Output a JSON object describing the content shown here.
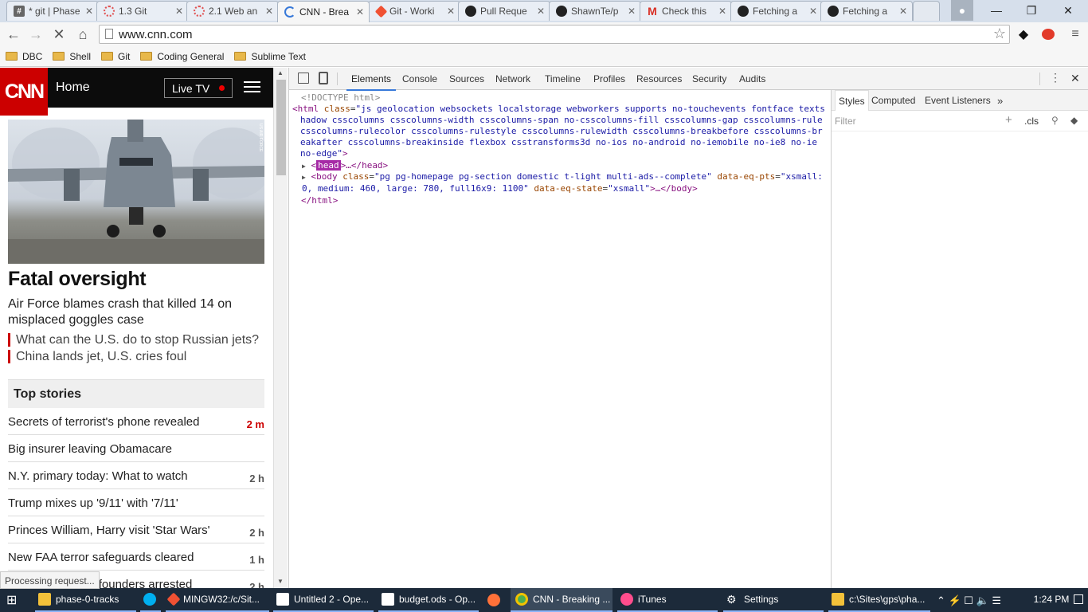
{
  "tabs": [
    {
      "title": "* git | Phase",
      "icon": "hash-icon",
      "color": "#555555"
    },
    {
      "title": "1.3 Git",
      "icon": "loading-icon",
      "color": "#e05050"
    },
    {
      "title": "2.1 Web an",
      "icon": "loading-icon",
      "color": "#e05050"
    },
    {
      "title": "CNN - Brea",
      "icon": "spinner-icon",
      "color": "#3879d9"
    },
    {
      "title": "Git - Worki",
      "icon": "git-icon",
      "color": "#f05133"
    },
    {
      "title": "Pull Reque",
      "icon": "github-icon",
      "color": "#222222"
    },
    {
      "title": "ShawnTe/p",
      "icon": "github-icon",
      "color": "#222222"
    },
    {
      "title": "Check this",
      "icon": "gmail-icon",
      "color": "#d93025"
    },
    {
      "title": "Fetching a",
      "icon": "github-icon",
      "color": "#222222"
    },
    {
      "title": "Fetching a",
      "icon": "github-icon",
      "color": "#222222"
    }
  ],
  "omnibox": {
    "url": "www.cnn.com"
  },
  "bookmarks": [
    "DBC",
    "Shell",
    "Git",
    "Coding General",
    "Sublime Text"
  ],
  "cnn": {
    "logo": "CNN",
    "home": "Home",
    "live_tv": "Live TV",
    "hero_credit": "US AIR FORCE",
    "headline": "Fatal oversight",
    "subhead": "Air Force blames crash that killed 14 on misplaced goggles case",
    "related": [
      "What can the U.S. do to stop Russian jets?",
      "China lands jet, U.S. cries foul"
    ],
    "top_stories_title": "Top stories",
    "stories": [
      {
        "title": "Secrets of terrorist's phone revealed",
        "ago": "2 m"
      },
      {
        "title": "Big insurer leaving Obamacare",
        "ago": ""
      },
      {
        "title": "N.Y. primary today: What to watch",
        "ago": "2 h"
      },
      {
        "title": "Trump mixes up '9/11' with '7/11'",
        "ago": ""
      },
      {
        "title": "Princes William, Harry visit 'Star Wars'",
        "ago": "2 h"
      },
      {
        "title": "New FAA terror safeguards cleared",
        "ago": "1 h"
      },
      {
        "title": "Ben & Jerry's co-founders arrested",
        "ago": "2 h"
      }
    ],
    "status": "Processing request..."
  },
  "devtools": {
    "tabs": [
      "Elements",
      "Console",
      "Sources",
      "Network",
      "Timeline",
      "Profiles",
      "Resources",
      "Security",
      "Audits"
    ],
    "active_tab": "Elements",
    "doctype": "<!DOCTYPE html>",
    "html_open": "<html",
    "html_class_attr": "class",
    "html_class_value": "\"js geolocation websockets localstorage webworkers supports no-touchevents fontface textshadow csscolumns csscolumns-width csscolumns-span no-csscolumns-fill csscolumns-gap csscolumns-rule csscolumns-rulecolor csscolumns-rulestyle csscolumns-rulewidth csscolumns-breakbefore csscolumns-breakafter csscolumns-breakinside flexbox csstransforms3d no-ios no-android no-iemobile no-ie8 no-ie no-edge\"",
    "head_tag": "head",
    "head_rest": ">…</head>",
    "body_open": "<body",
    "body_class_attr": "class",
    "body_class_value": "\"pg pg-homepage pg-section domestic t-light multi-ads--complete\"",
    "body_pts_attr": "data-eq-pts",
    "body_pts_value": "\"xsmall: 0, medium: 460, large: 780, full16x9: 1100\"",
    "body_state_attr": "data-eq-state",
    "body_state_value": "\"xsmall\"",
    "body_rest": ">…</body>",
    "html_close": "</html>",
    "styles_tabs": [
      "Styles",
      "Computed",
      "Event Listeners"
    ],
    "filter_placeholder": "Filter",
    "cls": ".cls"
  },
  "taskbar": {
    "items": [
      {
        "label": "phase-0-tracks",
        "icon_color": "#f3c13a"
      },
      {
        "label": "",
        "icon_color": "#00aff0"
      },
      {
        "label": "MINGW32:/c/Sit...",
        "icon_color": "#f05133"
      },
      {
        "label": "Untitled 2 - Ope...",
        "icon_color": "#ffffff"
      },
      {
        "label": "budget.ods - Op...",
        "icon_color": "#ffffff"
      },
      {
        "label": "",
        "icon_color": "#ff7139"
      },
      {
        "label": "CNN - Breaking ...",
        "icon_color": "#4caf50"
      },
      {
        "label": "iTunes",
        "icon_color": "#ff4d8d"
      },
      {
        "label": "Settings",
        "icon_color": "#ffffff"
      },
      {
        "label": "c:\\Sites\\gps\\pha...",
        "icon_color": "#f3c13a"
      }
    ],
    "time": "1:24 PM"
  }
}
